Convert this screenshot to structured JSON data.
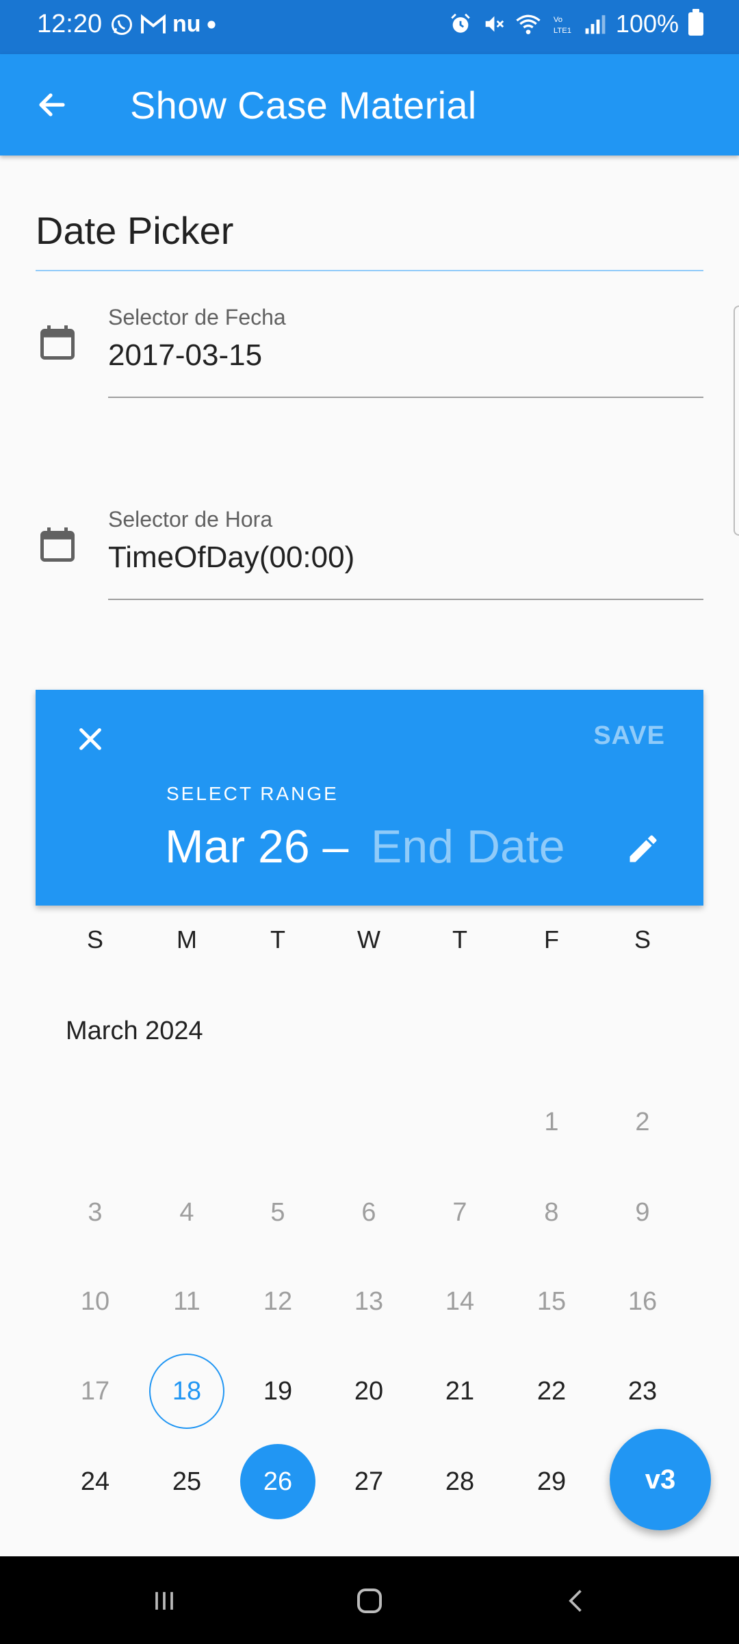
{
  "status_bar": {
    "time": "12:20",
    "left_icons": [
      "whatsapp-icon",
      "gmail-icon",
      "nu-icon",
      "dot-icon"
    ],
    "nu_text": "nu",
    "battery": "100%"
  },
  "app_bar": {
    "title": "Show Case Material"
  },
  "section": {
    "title": "Date Picker"
  },
  "date_field": {
    "label": "Selector de Fecha",
    "value": "2017-03-15"
  },
  "time_field": {
    "label": "Selector de Hora",
    "value": "TimeOfDay(00:00)"
  },
  "range_picker": {
    "save_label": "SAVE",
    "help_text": "SELECT RANGE",
    "start_date": "Mar 26 –",
    "end_placeholder": "End Date",
    "weekdays": [
      "S",
      "M",
      "T",
      "W",
      "T",
      "F",
      "S"
    ],
    "month_title": "March 2024",
    "days": [
      {
        "label": "1",
        "col": 5,
        "row": 0,
        "state": "disabled"
      },
      {
        "label": "2",
        "col": 6,
        "row": 0,
        "state": "disabled"
      },
      {
        "label": "3",
        "col": 0,
        "row": 1,
        "state": "disabled"
      },
      {
        "label": "4",
        "col": 1,
        "row": 1,
        "state": "disabled"
      },
      {
        "label": "5",
        "col": 2,
        "row": 1,
        "state": "disabled"
      },
      {
        "label": "6",
        "col": 3,
        "row": 1,
        "state": "disabled"
      },
      {
        "label": "7",
        "col": 4,
        "row": 1,
        "state": "disabled"
      },
      {
        "label": "8",
        "col": 5,
        "row": 1,
        "state": "disabled"
      },
      {
        "label": "9",
        "col": 6,
        "row": 1,
        "state": "disabled"
      },
      {
        "label": "10",
        "col": 0,
        "row": 2,
        "state": "disabled"
      },
      {
        "label": "11",
        "col": 1,
        "row": 2,
        "state": "disabled"
      },
      {
        "label": "12",
        "col": 2,
        "row": 2,
        "state": "disabled"
      },
      {
        "label": "13",
        "col": 3,
        "row": 2,
        "state": "disabled"
      },
      {
        "label": "14",
        "col": 4,
        "row": 2,
        "state": "disabled"
      },
      {
        "label": "15",
        "col": 5,
        "row": 2,
        "state": "disabled"
      },
      {
        "label": "16",
        "col": 6,
        "row": 2,
        "state": "disabled"
      },
      {
        "label": "17",
        "col": 0,
        "row": 3,
        "state": "disabled"
      },
      {
        "label": "18",
        "col": 1,
        "row": 3,
        "state": "today"
      },
      {
        "label": "19",
        "col": 2,
        "row": 3,
        "state": "enabled"
      },
      {
        "label": "20",
        "col": 3,
        "row": 3,
        "state": "enabled"
      },
      {
        "label": "21",
        "col": 4,
        "row": 3,
        "state": "enabled"
      },
      {
        "label": "22",
        "col": 5,
        "row": 3,
        "state": "enabled"
      },
      {
        "label": "23",
        "col": 6,
        "row": 3,
        "state": "enabled"
      },
      {
        "label": "24",
        "col": 0,
        "row": 4,
        "state": "enabled"
      },
      {
        "label": "25",
        "col": 1,
        "row": 4,
        "state": "enabled"
      },
      {
        "label": "26",
        "col": 2,
        "row": 4,
        "state": "selected"
      },
      {
        "label": "27",
        "col": 3,
        "row": 4,
        "state": "enabled"
      },
      {
        "label": "28",
        "col": 4,
        "row": 4,
        "state": "enabled"
      },
      {
        "label": "29",
        "col": 5,
        "row": 4,
        "state": "enabled"
      }
    ]
  },
  "fab": {
    "label": "v3"
  },
  "colors": {
    "status_bar": "#1976d2",
    "primary": "#2196f3",
    "disabled_text": "#9e9e9e"
  }
}
